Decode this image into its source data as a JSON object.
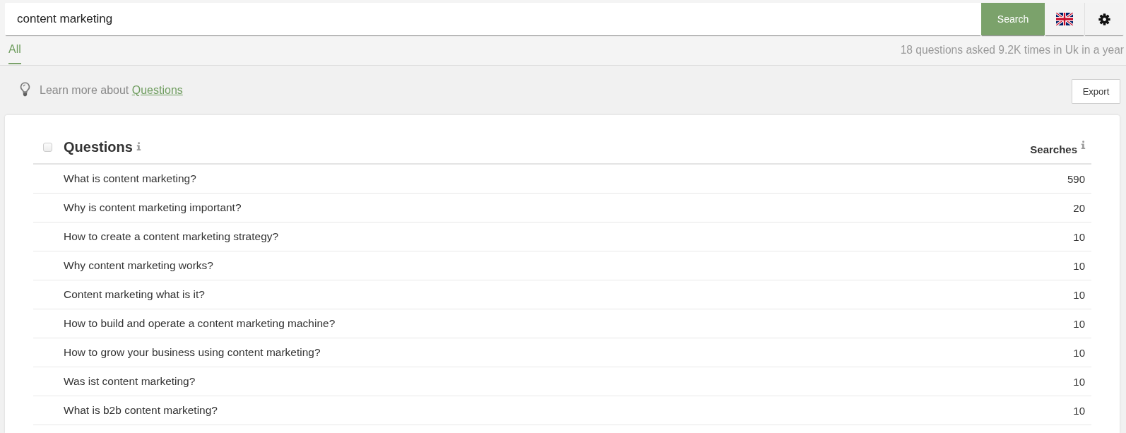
{
  "search": {
    "value": "content marketing",
    "button": "Search"
  },
  "tabs": [
    {
      "label": "All",
      "selected": true
    }
  ],
  "summary": "18 questions asked 9.2K times in Uk in a year",
  "info_banner": {
    "text": "Learn more about",
    "link": "Questions"
  },
  "export_button": "Export",
  "table": {
    "select_all": {
      "checked": false
    },
    "columns": [
      {
        "label": "Questions"
      },
      {
        "label": "Searches"
      }
    ],
    "rows": [
      {
        "question": "What is content marketing?",
        "searches": "590"
      },
      {
        "question": "Why is content marketing important?",
        "searches": "20"
      },
      {
        "question": "How to create a content marketing strategy?",
        "searches": "10"
      },
      {
        "question": "Why content marketing works?",
        "searches": "10"
      },
      {
        "question": "Content marketing what is it?",
        "searches": "10"
      },
      {
        "question": "How to build and operate a content marketing machine?",
        "searches": "10"
      },
      {
        "question": "How to grow your business using content marketing?",
        "searches": "10"
      },
      {
        "question": "Was ist content marketing?",
        "searches": "10"
      },
      {
        "question": "What is b2b content marketing?",
        "searches": "10"
      }
    ]
  }
}
